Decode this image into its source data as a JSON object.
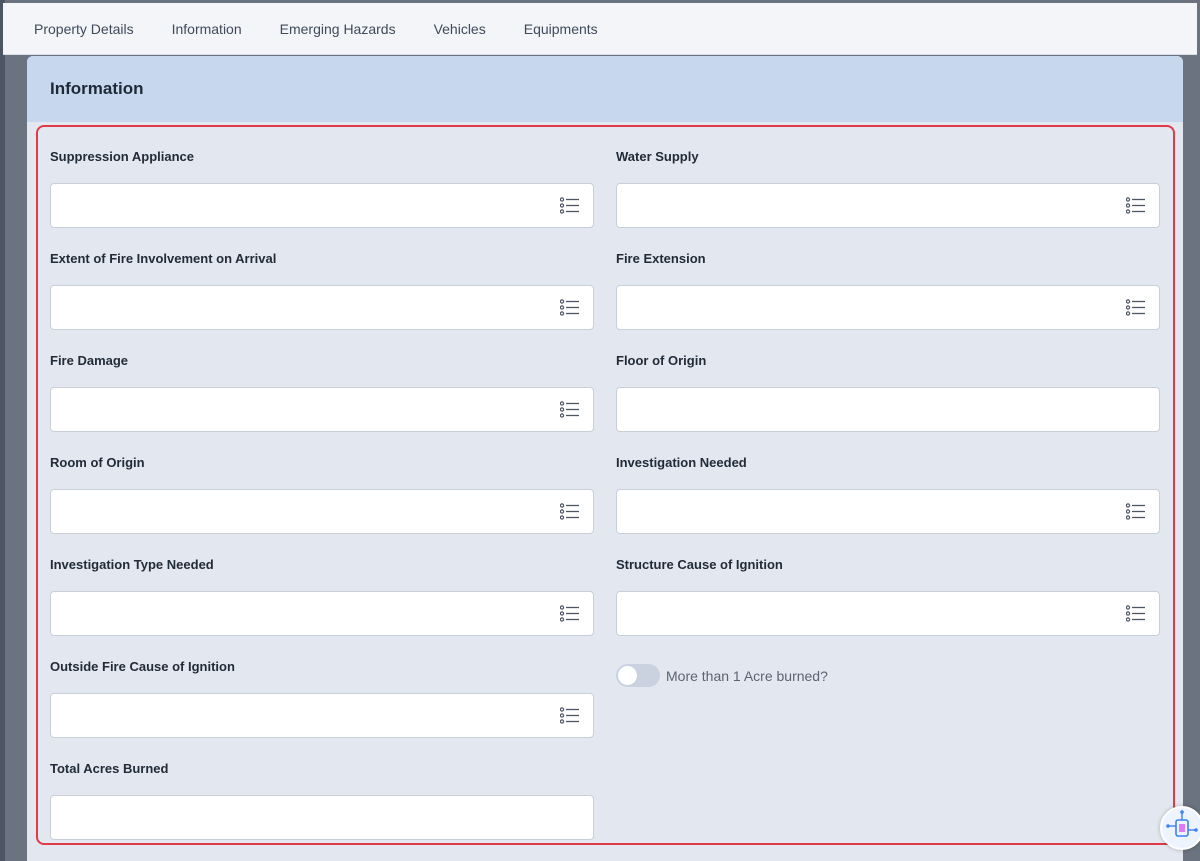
{
  "tabs": [
    {
      "label": "Property Details"
    },
    {
      "label": "Information"
    },
    {
      "label": "Emerging Hazards"
    },
    {
      "label": "Vehicles"
    },
    {
      "label": "Equipments"
    }
  ],
  "card": {
    "title": "Information"
  },
  "fields": {
    "suppression_appliance": {
      "label": "Suppression Appliance",
      "value": ""
    },
    "water_supply": {
      "label": "Water Supply",
      "value": ""
    },
    "extent_of_fire": {
      "label": "Extent of Fire Involvement on Arrival",
      "value": ""
    },
    "fire_extension": {
      "label": "Fire Extension",
      "value": ""
    },
    "fire_damage": {
      "label": "Fire Damage",
      "value": ""
    },
    "floor_of_origin": {
      "label": "Floor of Origin",
      "value": ""
    },
    "room_of_origin": {
      "label": "Room of Origin",
      "value": ""
    },
    "investigation_needed": {
      "label": "Investigation Needed",
      "value": ""
    },
    "investigation_type_needed": {
      "label": "Investigation Type Needed",
      "value": ""
    },
    "structure_cause": {
      "label": "Structure Cause of Ignition",
      "value": ""
    },
    "outside_fire_cause": {
      "label": "Outside Fire Cause of Ignition",
      "value": ""
    },
    "total_acres_burned": {
      "label": "Total Acres Burned",
      "value": ""
    }
  },
  "acre_toggle": {
    "label": "More than 1 Acre burned?",
    "checked": false
  },
  "colors": {
    "highlight": "#e03a48",
    "header": "#c6d7ee",
    "panel": "#e3e8f0"
  }
}
